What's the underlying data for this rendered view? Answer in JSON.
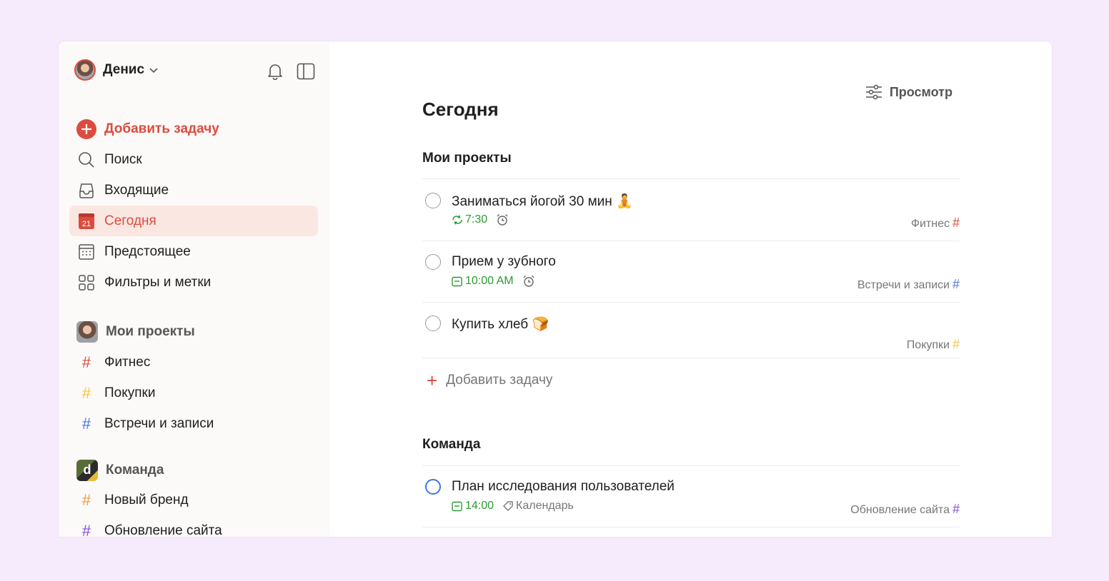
{
  "user": {
    "name": "Денис"
  },
  "nav": {
    "add_task": "Добавить задачу",
    "search": "Поиск",
    "inbox": "Входящие",
    "today": "Сегодня",
    "today_date": "21",
    "upcoming": "Предстоящее",
    "filters": "Фильтры и метки"
  },
  "sections": {
    "my_projects": {
      "title": "Мои проекты",
      "projects": [
        {
          "name": "Фитнес",
          "color": "#dc4c3e"
        },
        {
          "name": "Покупки",
          "color": "#f5c642"
        },
        {
          "name": "Встречи и записи",
          "color": "#4a73e8"
        }
      ]
    },
    "team": {
      "title": "Команда",
      "avatar_letter": "d",
      "projects": [
        {
          "name": "Новый бренд",
          "color": "#f19a3e"
        },
        {
          "name": "Обновление сайта",
          "color": "#7b52d6"
        }
      ]
    }
  },
  "main": {
    "view_label": "Просмотр",
    "title": "Сегодня",
    "groups": [
      {
        "title": "Мои проекты",
        "tasks": [
          {
            "title": "Заниматься йогой 30 мин 🧘",
            "time": "7:30",
            "project": "Фитнес",
            "project_color": "#dc4c3e"
          },
          {
            "title": "Прием у зубного",
            "time": "10:00 AM",
            "project": "Встречи и записи",
            "project_color": "#4a73e8"
          },
          {
            "title": "Купить хлеб 🍞",
            "project": "Покупки",
            "project_color": "#f5c642"
          }
        ],
        "add_task": "Добавить задачу"
      },
      {
        "title": "Команда",
        "tasks": [
          {
            "title": "План исследования пользователей",
            "time": "14:00",
            "label": "Календарь",
            "project": "Обновление сайта",
            "project_color": "#7b52d6"
          }
        ]
      }
    ]
  },
  "colors": {
    "accent": "#dc4c3e",
    "green": "#2a9b33",
    "active_bg": "#fbe7e2"
  }
}
